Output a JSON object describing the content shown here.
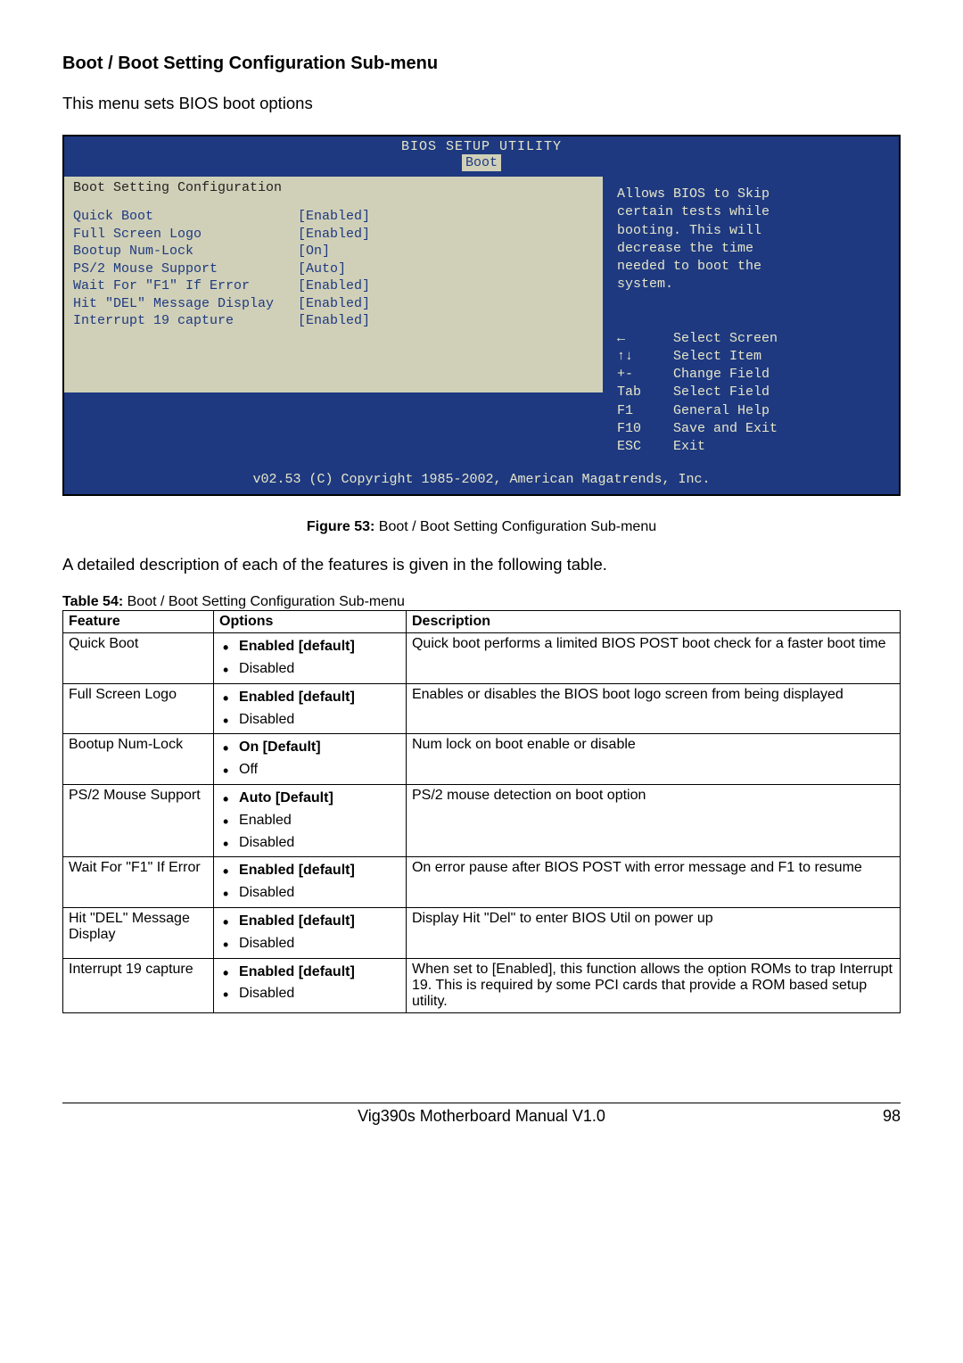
{
  "heading": "Boot / Boot Setting Configuration Sub-menu",
  "intro": "This menu sets BIOS boot options",
  "bios": {
    "title": "BIOS SETUP UTILITY",
    "tab": "Boot",
    "section_title": "Boot Setting Configuration",
    "settings_block": "Quick Boot                  [Enabled]\nFull Screen Logo            [Enabled]\nBootup Num-Lock             [On]\nPS/2 Mouse Support          [Auto]\nWait For \"F1\" If Error      [Enabled]\nHit \"DEL\" Message Display   [Enabled]\nInterrupt 19 capture        [Enabled]",
    "help_text": "Allows BIOS to Skip\ncertain tests while\nbooting. This will\ndecrease the time\nneeded to boot the\nsystem.",
    "keys_block": "←      Select Screen\n↑↓     Select Item\n+-     Change Field\nTab    Select Field\nF1     General Help\nF10    Save and Exit\nESC    Exit",
    "footer": "v02.53 (C) Copyright 1985-2002, American Magatrends, Inc."
  },
  "figure_label": "Figure 53:",
  "figure_text": " Boot / Boot Setting Configuration Sub-menu",
  "para_desc": "A detailed description of each of the features is given in the following table.",
  "table_label": "Table 54:",
  "table_text": " Boot / Boot Setting Configuration Sub-menu",
  "table": {
    "headers": [
      "Feature",
      "Options",
      "Description"
    ],
    "rows": [
      {
        "feature": "Quick Boot",
        "options": [
          {
            "label": "Enabled [default]",
            "bold": true
          },
          {
            "label": "Disabled",
            "bold": false
          }
        ],
        "description": "Quick boot performs a limited BIOS POST boot check for a faster boot time"
      },
      {
        "feature": "Full Screen Logo",
        "options": [
          {
            "label": "Enabled [default]",
            "bold": true
          },
          {
            "label": "Disabled",
            "bold": false
          }
        ],
        "description": "Enables or disables the BIOS boot logo screen from being displayed"
      },
      {
        "feature": "Bootup Num-Lock",
        "options": [
          {
            "label": "On [Default]",
            "bold": true
          },
          {
            "label": "Off",
            "bold": false
          }
        ],
        "description": "Num lock on boot enable or disable"
      },
      {
        "feature": "PS/2 Mouse Support",
        "options": [
          {
            "label": "Auto [Default]",
            "bold": true
          },
          {
            "label": "Enabled",
            "bold": false
          },
          {
            "label": "Disabled",
            "bold": false
          }
        ],
        "description": "PS/2 mouse detection on boot option"
      },
      {
        "feature": "Wait For \"F1\" If Error",
        "options": [
          {
            "label": "Enabled [default]",
            "bold": true
          },
          {
            "label": "Disabled",
            "bold": false
          }
        ],
        "description": "On error pause after BIOS POST with error message and F1 to resume"
      },
      {
        "feature": "Hit \"DEL\" Message Display",
        "options": [
          {
            "label": "Enabled [default]",
            "bold": true
          },
          {
            "label": "Disabled",
            "bold": false
          }
        ],
        "description": "Display Hit \"Del\" to enter BIOS Util on power up"
      },
      {
        "feature": "Interrupt 19 capture",
        "options": [
          {
            "label": "Enabled [default]",
            "bold": true
          },
          {
            "label": "Disabled",
            "bold": false
          }
        ],
        "description": "When set to [Enabled], this function allows the option ROMs to trap Interrupt 19. This is required by some PCI cards that provide a ROM based setup utility."
      }
    ]
  },
  "footer_title": "Vig390s Motherboard Manual V1.0",
  "footer_page": "98"
}
